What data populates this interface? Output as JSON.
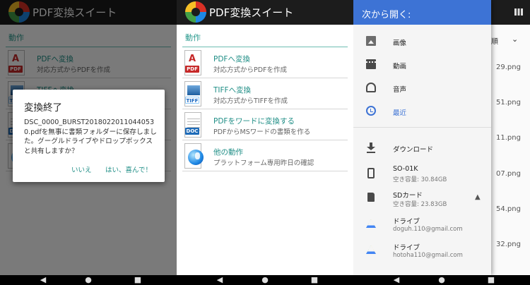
{
  "app": {
    "title": "PDF変換スイート"
  },
  "section": {
    "label": "動作"
  },
  "menu": [
    {
      "title": "PDFへ変換",
      "subtitle": "対応方式からPDFを作成",
      "icon": "pdf-document-icon",
      "tag": "PDF"
    },
    {
      "title": "TIFFへ変換",
      "subtitle": "対応方式からTIFFを作成",
      "icon": "tiff-document-icon",
      "tag": "TIFF"
    },
    {
      "title": "PDFをワードに変換する",
      "subtitle": "PDFからMSワードの書類を作る",
      "icon": "word-document-icon",
      "tag": "DOC"
    },
    {
      "title": "他の動作",
      "subtitle": "プラットフォーム専用昨日の確認",
      "icon": "globe-icon"
    }
  ],
  "dialog": {
    "title": "変換終了",
    "message": "DSC_0000_BURST20180220110440530.pdfを無事に書類フォルダーに保存しました。グーグルドライブやドロップボックスと共有しますか？",
    "no_label": "いいえ",
    "yes_label": "はい、喜んで！"
  },
  "drawer": {
    "title": "次から開く:",
    "media": [
      {
        "label": "画像",
        "icon": "image-icon"
      },
      {
        "label": "動画",
        "icon": "video-icon"
      },
      {
        "label": "音声",
        "icon": "audio-icon"
      },
      {
        "label": "最近",
        "icon": "recent-icon"
      }
    ],
    "download_label": "ダウンロード",
    "storage": [
      {
        "label": "SO-01K",
        "sub": "空き容量: 30.84GB",
        "icon": "phone-icon"
      },
      {
        "label": "SDカード",
        "sub": "空き容量: 23.83GB",
        "icon": "sd-card-icon"
      },
      {
        "label": "ドライブ",
        "sub": "doguh.110@gmail.com",
        "icon": "google-drive-icon"
      },
      {
        "label": "ドライブ",
        "sub": "hotoha110@gmail.com",
        "icon": "google-drive-icon"
      }
    ]
  },
  "background_files": {
    "sort_label": "順",
    "files": [
      "29.png",
      "51.png",
      "11.png",
      "07.png",
      "54.png",
      "32.png"
    ]
  },
  "nav": {
    "back": "◀",
    "home": "●",
    "recents": "■"
  },
  "colors": {
    "accent_teal": "#1f8e86",
    "drawer_blue": "#3d73d5",
    "appbar": "#1c1c1c"
  }
}
